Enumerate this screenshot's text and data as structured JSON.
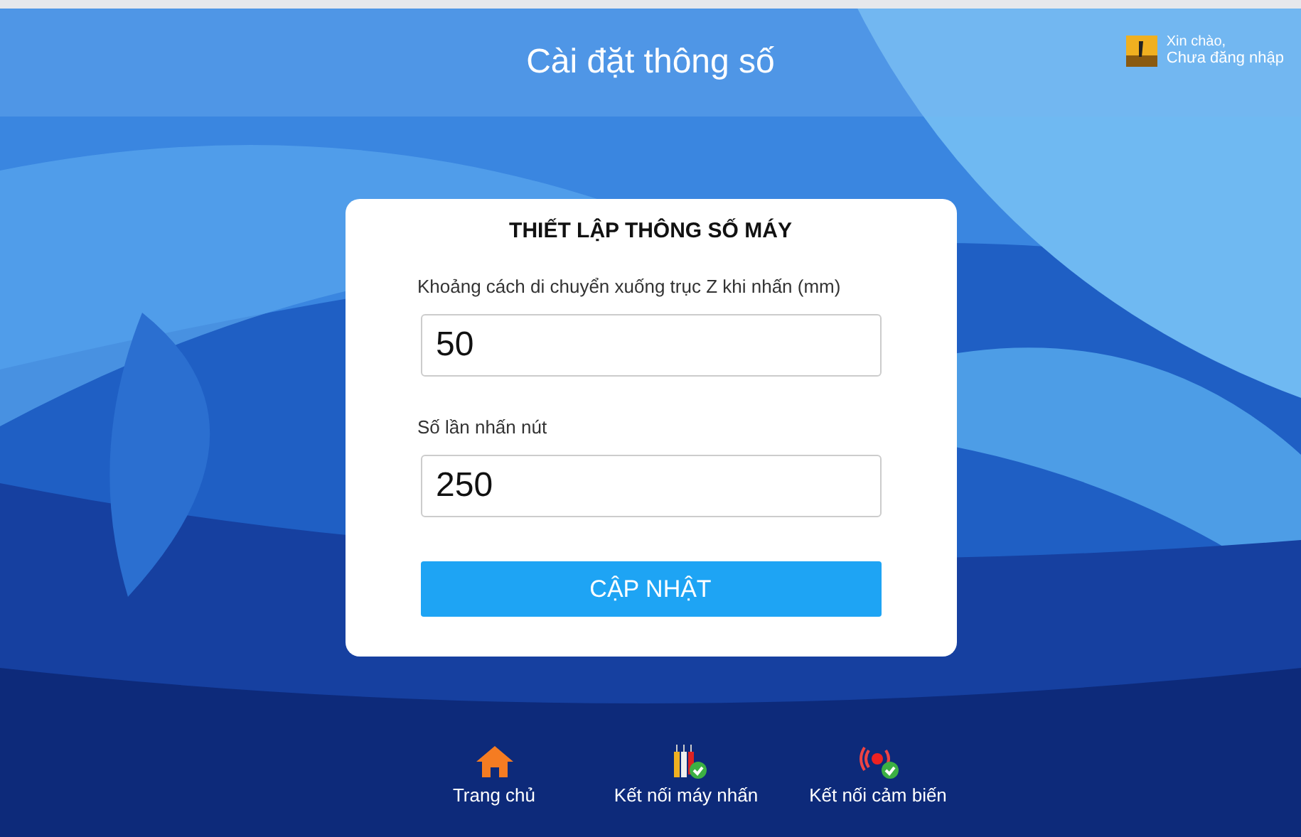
{
  "header": {
    "title": "Cài đặt thông số",
    "user": {
      "greeting": "Xin chào,",
      "status": "Chưa đăng nhập"
    }
  },
  "form": {
    "title": "THIẾT LẬP THÔNG SỐ MÁY",
    "fields": [
      {
        "label": "Khoảng cách di chuyển xuống trục Z khi nhấn (mm)",
        "value": "50"
      },
      {
        "label": "Số lần nhấn nút",
        "value": "250"
      }
    ],
    "button": "CẬP NHẬT"
  },
  "nav": [
    {
      "kind": "home",
      "label": "Trang chủ"
    },
    {
      "kind": "press",
      "label": "Kết nối máy nhấn",
      "connected": true
    },
    {
      "kind": "sensor",
      "label": "Kết nối cảm biến",
      "connected": true
    }
  ]
}
